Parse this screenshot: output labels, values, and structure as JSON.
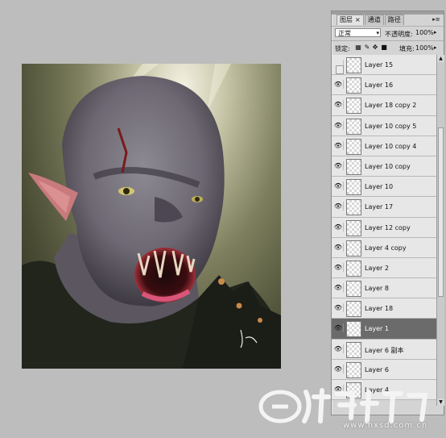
{
  "panel": {
    "tabs": [
      {
        "label": "图层",
        "close": "×",
        "active": true
      },
      {
        "label": "通道",
        "active": false
      },
      {
        "label": "路径",
        "active": false
      }
    ],
    "menu_glyph": "▸≡",
    "blend_mode": "正常",
    "opacity_label": "不透明度:",
    "opacity_value": "100%",
    "lock_label": "锁定:",
    "fill_label": "填充:",
    "fill_value": "100%",
    "layers": [
      {
        "name": "Layer 15",
        "visible": false,
        "selected": false
      },
      {
        "name": "Layer 16",
        "visible": true,
        "selected": false
      },
      {
        "name": "Layer 18 copy 2",
        "visible": true,
        "selected": false
      },
      {
        "name": "Layer 10 copy 5",
        "visible": true,
        "selected": false
      },
      {
        "name": "Layer 10 copy 4",
        "visible": true,
        "selected": false
      },
      {
        "name": "Layer 10 copy",
        "visible": true,
        "selected": false
      },
      {
        "name": "Layer 10",
        "visible": true,
        "selected": false
      },
      {
        "name": "Layer 17",
        "visible": true,
        "selected": false
      },
      {
        "name": "Layer 12 copy",
        "visible": true,
        "selected": false
      },
      {
        "name": "Layer 4 copy",
        "visible": true,
        "selected": false
      },
      {
        "name": "Layer 2",
        "visible": true,
        "selected": false
      },
      {
        "name": "Layer 8",
        "visible": true,
        "selected": false
      },
      {
        "name": "Layer 18",
        "visible": true,
        "selected": false
      },
      {
        "name": "Layer 1",
        "visible": true,
        "selected": true
      },
      {
        "name": "Layer 6 副本",
        "visible": true,
        "selected": false
      },
      {
        "name": "Layer 6",
        "visible": true,
        "selected": false
      },
      {
        "name": "Layer 4",
        "visible": true,
        "selected": false
      }
    ]
  },
  "watermark": {
    "url": "www.hxsd.com.cn"
  },
  "colors": {
    "background": "#bdbdbd",
    "panel": "#d4d4d4",
    "selected_layer": "#6b6b6b"
  }
}
